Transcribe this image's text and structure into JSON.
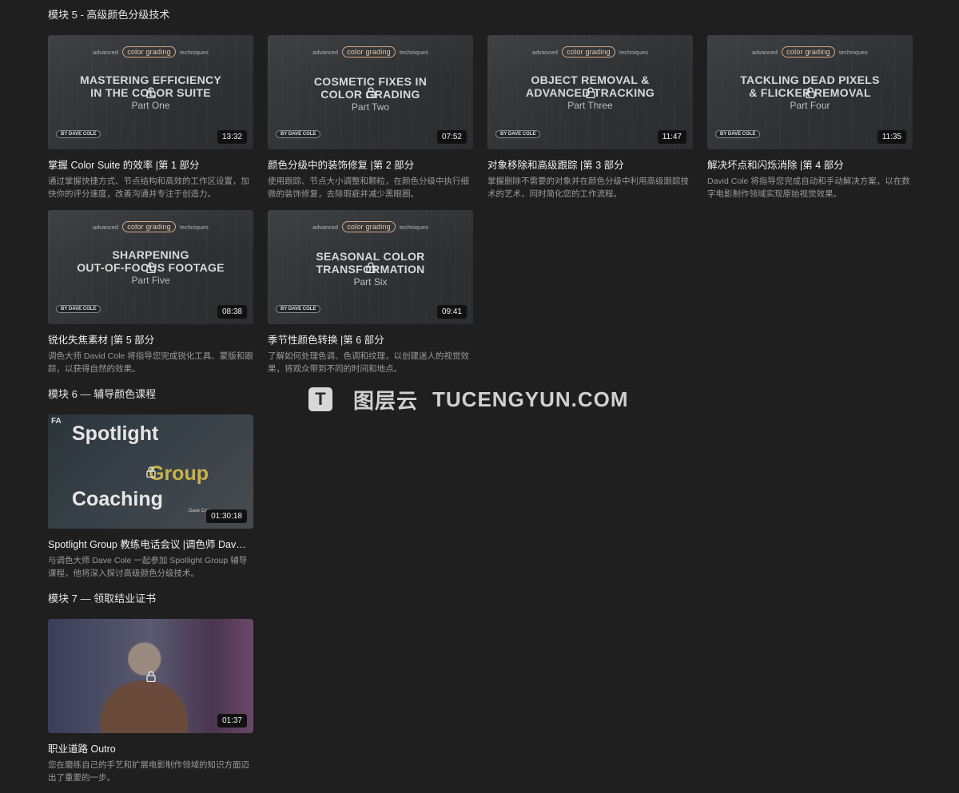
{
  "sections": {
    "module5": "模块 5 - 高级颜色分级技术",
    "module6": "模块 6 — 辅导颜色课程",
    "module7": "模块 7 — 领取结业证书"
  },
  "thumb_brand": {
    "left": "advanced",
    "pill": "color grading",
    "right": "techniques",
    "byline": "BY DAVE COLE"
  },
  "cards": [
    {
      "headline1": "MASTERING EFFICIENCY",
      "headline2": "IN THE COLOR SUITE",
      "part": "Part One",
      "duration": "13:32",
      "title": "掌握 Color Suite 的效率 |第 1 部分",
      "desc": "通过掌握快捷方式、节点结构和高效的工作区设置，加快你的评分速度，改善沟通并专注于创造力。"
    },
    {
      "headline1": "COSMETIC FIXES IN",
      "headline2": "COLOR GRADING",
      "part": "Part Two",
      "duration": "07:52",
      "title": "颜色分级中的装饰修复 |第 2 部分",
      "desc": "使用跟踪、节点大小调整和颗粒，在颜色分级中执行细微的装饰修复，去除瑕疵并减少黑眼圈。"
    },
    {
      "headline1": "OBJECT REMOVAL &",
      "headline2": "ADVANCED TRACKING",
      "part": "Part Three",
      "duration": "11:47",
      "title": "对象移除和高级跟踪 |第 3 部分",
      "desc": "掌握删除不需要的对象并在颜色分级中利用高级跟踪技术的艺术，同时简化您的工作流程。"
    },
    {
      "headline1": "TACKLING DEAD PIXELS",
      "headline2": "& FLICKER REMOVAL",
      "part": "Part Four",
      "duration": "11:35",
      "title": "解决坏点和闪烁消除 |第 4 部分",
      "desc": "David Cole 将指导您完成自动和手动解决方案，以在数字电影制作领域实现原始视觉效果。"
    },
    {
      "headline1": "SHARPENING",
      "headline2": "OUT-OF-FOCUS FOOTAGE",
      "part": "Part Five",
      "duration": "08:38",
      "title": "锐化失焦素材 |第 5 部分",
      "desc": "调色大师 David Cole 将指导您完成锐化工具、蒙版和跟踪，以获得自然的效果。"
    },
    {
      "headline1": "SEASONAL COLOR",
      "headline2": "TRANSFORMATION",
      "part": "Part Six",
      "duration": "09:41",
      "title": "季节性颜色转换 |第 6 部分",
      "desc": "了解如何处理色调、色调和纹理，以创建迷人的视觉效果，将观众带到不同的时间和地点。"
    }
  ],
  "spotlight": {
    "logo": "FA",
    "word1": "Spotlight",
    "word2": "Group",
    "word3": "Coaching",
    "name": "Dave Cole",
    "duration": "01:30:18",
    "title": "Spotlight Group 教练电话会议 |调色师 Dav…",
    "desc": "与调色大师 Dave Cole 一起参加 Spotlight Group 辅导课程，他将深入探讨高级颜色分级技术。"
  },
  "outro": {
    "duration": "01:37",
    "title": "职业道路 Outro",
    "desc": "您在磨练自己的手艺和扩展电影制作领域的知识方面迈出了重要的一步。"
  },
  "watermark": {
    "logo": "T",
    "cn": "图层云",
    "en": "TUCENGYUN.COM"
  },
  "colors": {
    "background": "#1f1f1f",
    "duration_bg": "#111111",
    "brand_pill": "#d8a47c",
    "group_accent": "#c9b24a"
  }
}
